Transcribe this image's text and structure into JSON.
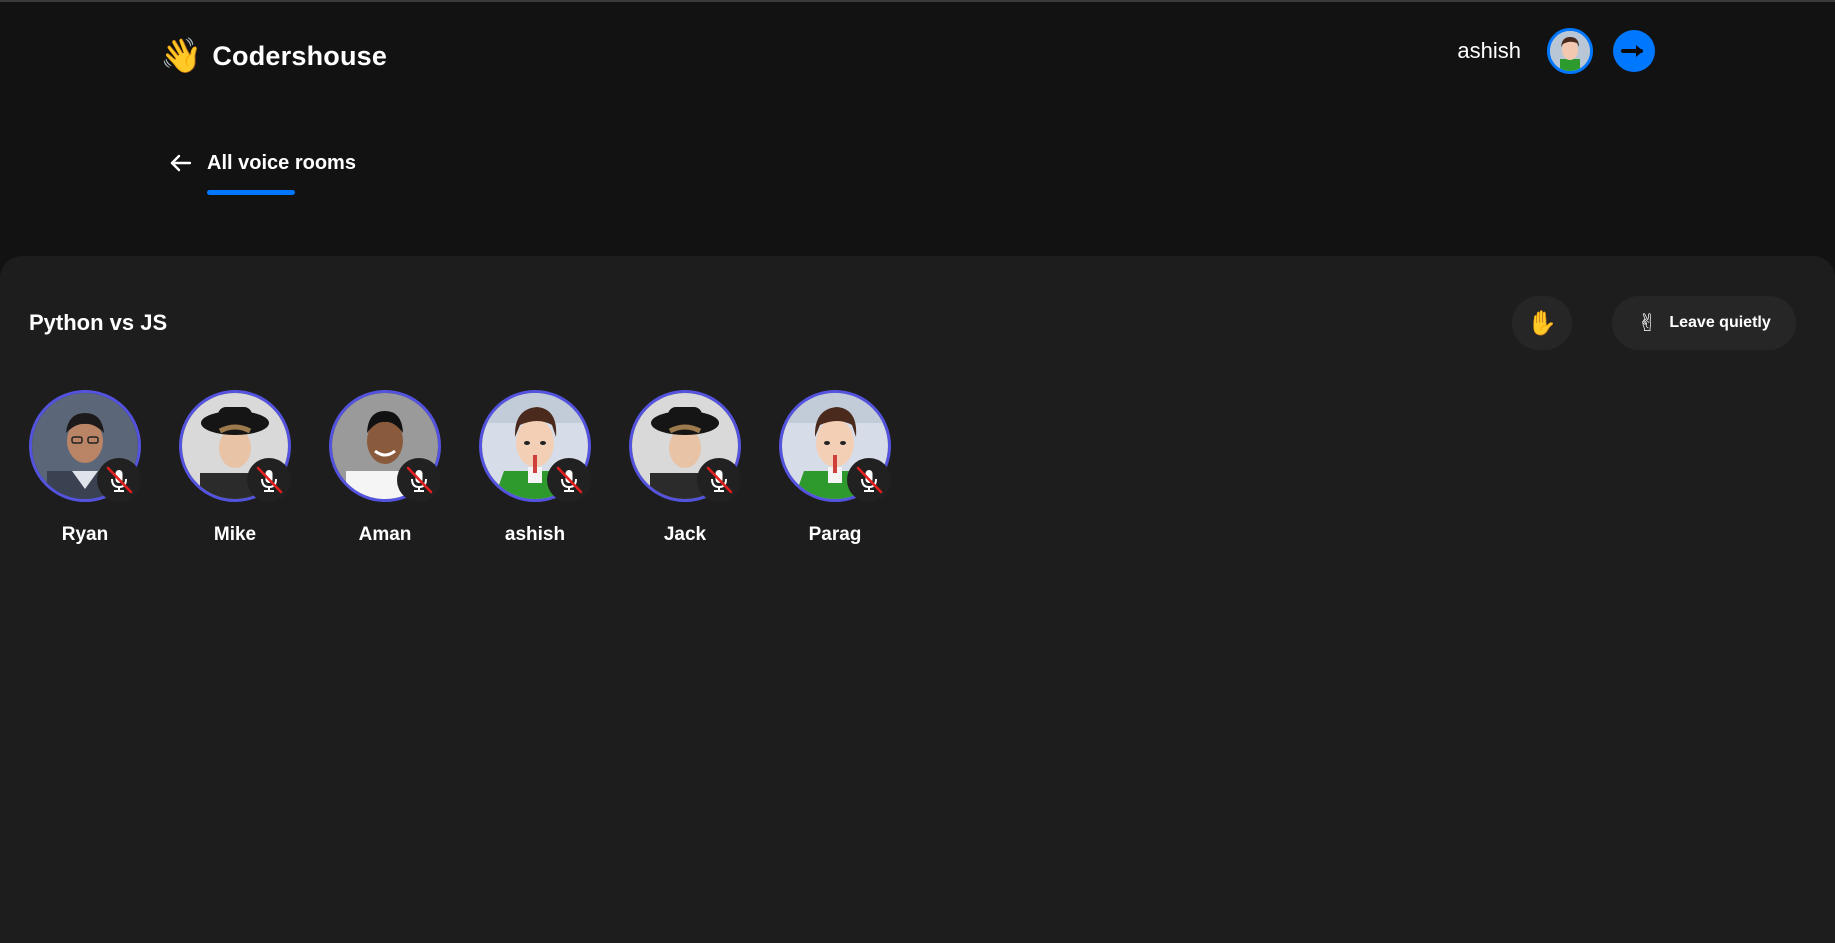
{
  "app": {
    "brand_emoji": "👋",
    "brand_name": "Codershouse"
  },
  "header": {
    "username": "ashish",
    "avatar_icon": "user-avatar-cartoon",
    "logout_icon": "arrow-right-icon",
    "accent_color": "#0077ff"
  },
  "subheader": {
    "back_icon": "arrow-left-icon",
    "title": "All voice rooms"
  },
  "room": {
    "title": "Python vs JS",
    "raise_hand_emoji": "✋",
    "leave_emoji": "✌",
    "leave_label": "Leave quietly",
    "speakers": [
      {
        "name": "Ryan",
        "avatar": "photo-man-glasses",
        "muted": true
      },
      {
        "name": "Mike",
        "avatar": "photo-boy-hat",
        "muted": true
      },
      {
        "name": "Aman",
        "avatar": "photo-man-smiling",
        "muted": true
      },
      {
        "name": "ashish",
        "avatar": "cartoon-boy",
        "muted": true
      },
      {
        "name": "Jack",
        "avatar": "photo-boy-hat",
        "muted": true
      },
      {
        "name": "Parag",
        "avatar": "cartoon-boy",
        "muted": true
      }
    ]
  },
  "colors": {
    "background": "#121212",
    "panel": "#1d1d1d",
    "avatar_border": "#5453e0",
    "mute_slash": "#e01e1e"
  }
}
